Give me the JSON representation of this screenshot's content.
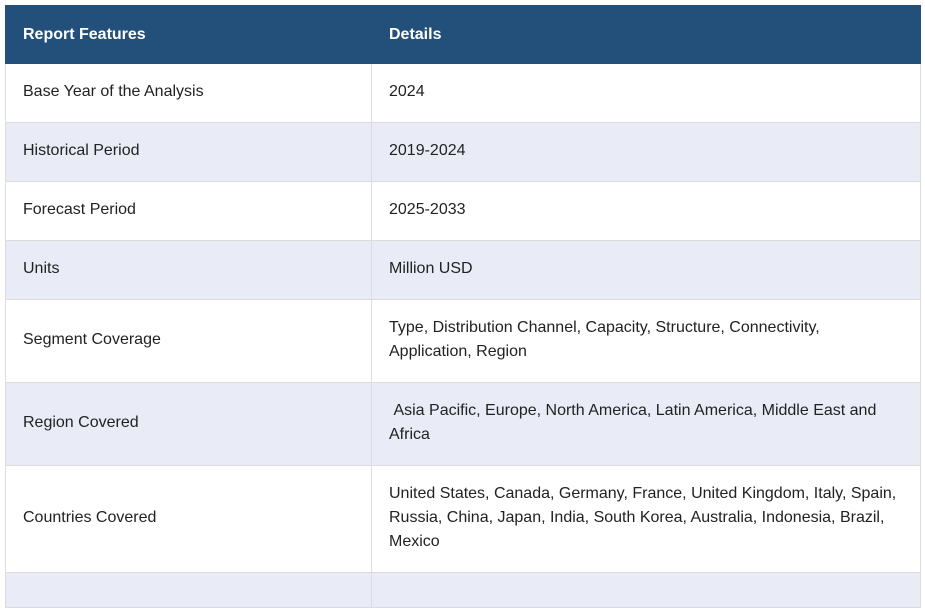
{
  "table": {
    "headers": [
      "Report Features",
      "Details"
    ],
    "rows": [
      {
        "feature": "Base Year of the Analysis",
        "detail": "2024"
      },
      {
        "feature": "Historical Period",
        "detail": "2019-2024"
      },
      {
        "feature": "Forecast Period",
        "detail": "2025-2033"
      },
      {
        "feature": "Units",
        "detail": "Million USD"
      },
      {
        "feature": "Segment Coverage",
        "detail": "Type, Distribution Channel, Capacity, Structure, Connectivity, Application, Region"
      },
      {
        "feature": "Region Covered",
        "detail": " Asia Pacific, Europe, North America, Latin America, Middle East and Africa"
      },
      {
        "feature": "Countries Covered",
        "detail": "United States, Canada, Germany, France, United Kingdom, Italy, Spain, Russia, China, Japan, India, South Korea, Australia, Indonesia, Brazil, Mexico"
      }
    ]
  },
  "colors": {
    "header_bg": "#22507a",
    "header_text": "#ffffff",
    "row_alt_bg": "#e9ebf7",
    "row_bg": "#ffffff",
    "border": "#dcdcdc"
  }
}
